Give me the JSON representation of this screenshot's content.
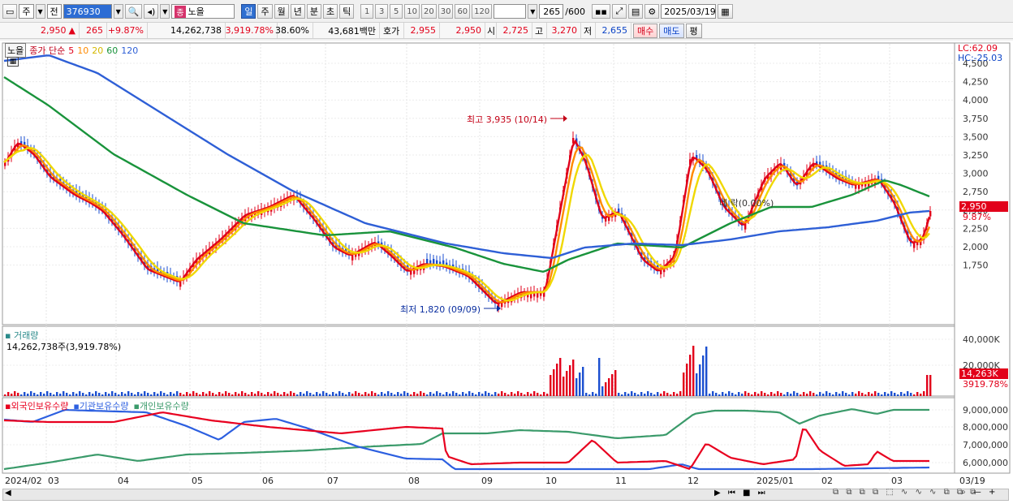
{
  "toolbar": {
    "type_label": "주",
    "prev_label": "전",
    "code": "376930",
    "name": "노을",
    "name_prefix": "종",
    "periods": [
      "일",
      "주",
      "월",
      "년",
      "분",
      "초",
      "틱"
    ],
    "active_period": "일",
    "intervals": [
      "1",
      "3",
      "5",
      "10",
      "20",
      "30",
      "60",
      "120"
    ],
    "count": "265",
    "count_total": "/600",
    "date": "2025/03/19"
  },
  "quote": {
    "price": "2,950",
    "direction_icon": "▲",
    "change": "265",
    "change_pct": "+9.87%",
    "volume": "14,262,738",
    "volume_ratio": "3,919.78%",
    "turnover": "38.60%",
    "amount": "43,681백만",
    "ask_label": "호가",
    "ask_price": "2,955",
    "bid_price": "2,950",
    "open_label": "시",
    "open": "2,725",
    "high_label": "고",
    "high": "3,270",
    "low_label": "저",
    "low": "2,655",
    "buy_label": "매수",
    "sell_label": "매도",
    "eval_label": "평"
  },
  "legend": {
    "stock_name": "노을",
    "ma_label": "종가 단순",
    "ma_periods": [
      "5",
      "10",
      "20",
      "60",
      "120"
    ],
    "ma_colors": [
      "#e0001a",
      "#ff8a00",
      "#f0d800",
      "#19933b",
      "#2e5fd6"
    ]
  },
  "price_panel": {
    "lc": "LC:62.09",
    "hc": "HC:-25.03",
    "axis": [
      "4,500",
      "4,250",
      "4,000",
      "3,750",
      "3,500",
      "3,250",
      "3,000",
      "2,750",
      "2,500",
      "2,250",
      "2,000",
      "1,750"
    ],
    "current_price": "2,950",
    "current_change": "9.87%",
    "high_note": "최고 3,935 (10/14)",
    "low_note": "최저 1,820 (09/09)",
    "trend_note": "네 락(0.00%)"
  },
  "volume_panel": {
    "title": "거래량",
    "value": "14,262,738주(3,919.78%)",
    "axis": [
      "40,000K",
      "20,000K"
    ],
    "current": "14,263K",
    "current_ratio": "3919.78%"
  },
  "holdings_panel": {
    "series": [
      "외국인보유수량",
      "기관보유수량",
      "개인보유수량"
    ],
    "axis": [
      "9,000,000",
      "8,000,000",
      "7,000,000",
      "6,000,000"
    ]
  },
  "x_axis": [
    "2024/02",
    "03",
    "04",
    "05",
    "06",
    "07",
    "08",
    "09",
    "10",
    "11",
    "12",
    "2025/01",
    "02",
    "03",
    "03/19"
  ],
  "colors": {
    "up": "#e2001a",
    "down": "#0b43c6",
    "foreign": "#e8001f",
    "institution": "#2c5fe0",
    "individual": "#3a9a6a"
  }
}
